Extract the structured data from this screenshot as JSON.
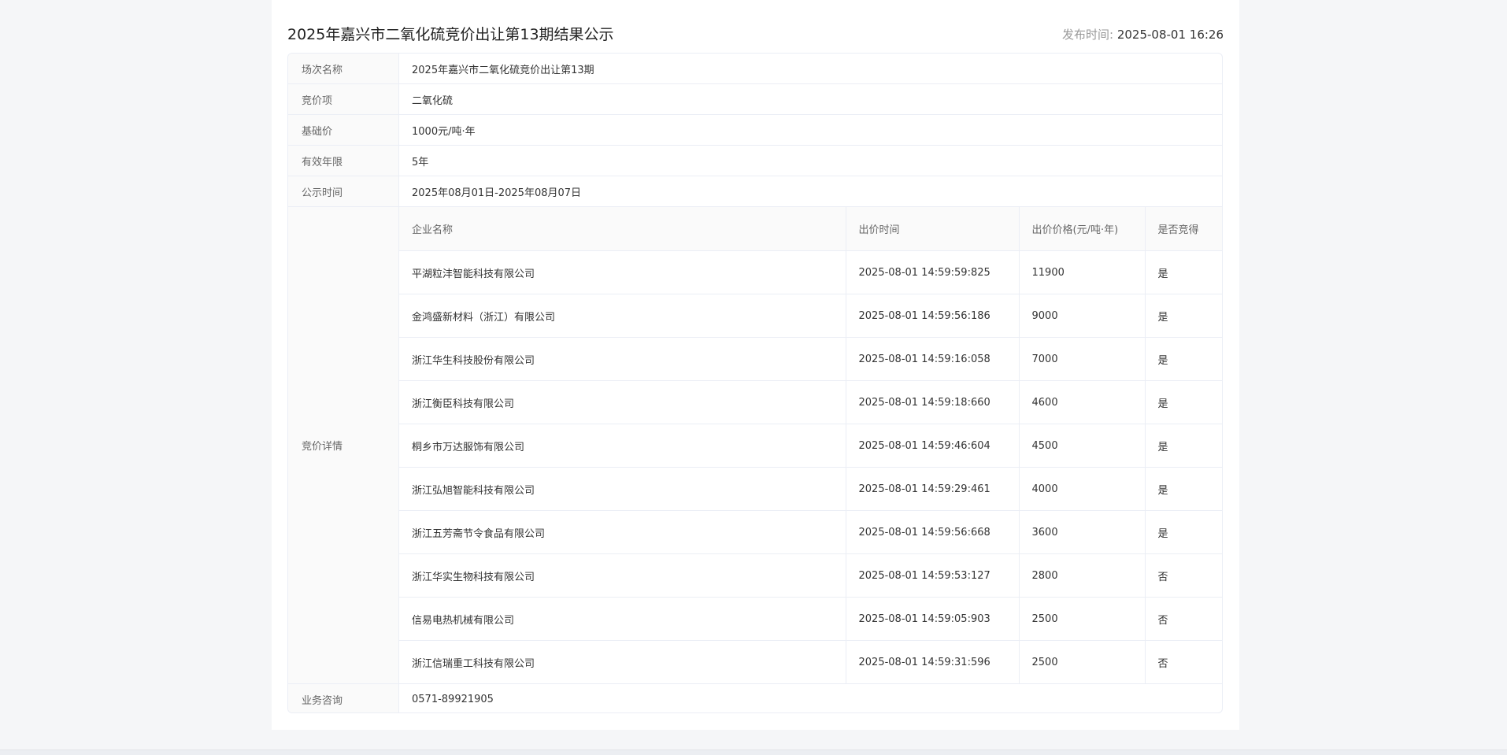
{
  "header": {
    "title": "2025年嘉兴市二氧化硫竞价出让第13期结果公示",
    "publish_label": "发布时间:",
    "publish_time": "2025-08-01 16:26"
  },
  "info": {
    "session_label": "场次名称",
    "session_value": "2025年嘉兴市二氧化硫竞价出让第13期",
    "item_label": "竞价项",
    "item_value": "二氧化硫",
    "base_price_label": "基础价",
    "base_price_value": "1000元/吨·年",
    "validity_label": "有效年限",
    "validity_value": "5年",
    "notice_period_label": "公示时间",
    "notice_period_value": "2025年08月01日-2025年08月07日",
    "detail_label": "竞价详情",
    "consult_label": "业务咨询",
    "consult_value": "0571-89921905"
  },
  "bids": {
    "columns": [
      "企业名称",
      "出价时间",
      "出价价格(元/吨·年)",
      "是否竞得"
    ],
    "rows": [
      [
        "平湖粒沣智能科技有限公司",
        "2025-08-01 14:59:59:825",
        "11900",
        "是"
      ],
      [
        "金鸿盛新材料（浙江）有限公司",
        "2025-08-01 14:59:56:186",
        "9000",
        "是"
      ],
      [
        "浙江华生科技股份有限公司",
        "2025-08-01 14:59:16:058",
        "7000",
        "是"
      ],
      [
        "浙江衡臣科技有限公司",
        "2025-08-01 14:59:18:660",
        "4600",
        "是"
      ],
      [
        "桐乡市万达服饰有限公司",
        "2025-08-01 14:59:46:604",
        "4500",
        "是"
      ],
      [
        "浙江弘旭智能科技有限公司",
        "2025-08-01 14:59:29:461",
        "4000",
        "是"
      ],
      [
        "浙江五芳斋节令食品有限公司",
        "2025-08-01 14:59:56:668",
        "3600",
        "是"
      ],
      [
        "浙江华实生物科技有限公司",
        "2025-08-01 14:59:53:127",
        "2800",
        "否"
      ],
      [
        "信易电热机械有限公司",
        "2025-08-01 14:59:05:903",
        "2500",
        "否"
      ],
      [
        "浙江信瑞重工科技有限公司",
        "2025-08-01 14:59:31:596",
        "2500",
        "否"
      ]
    ]
  }
}
